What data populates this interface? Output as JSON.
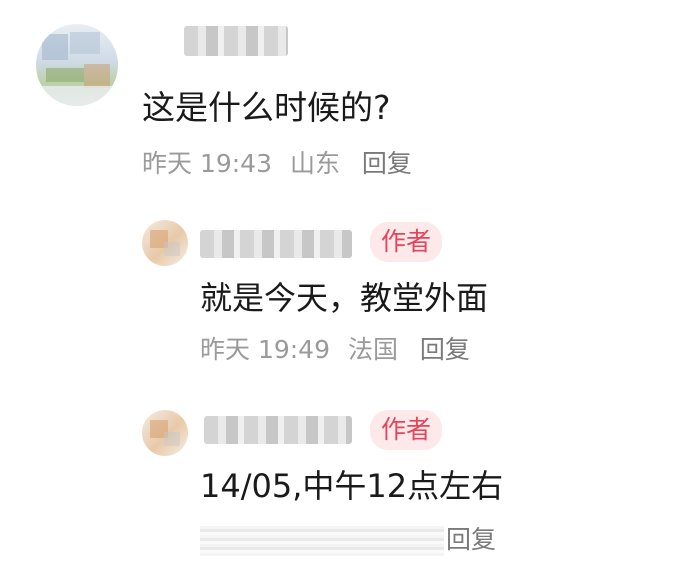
{
  "comments": [
    {
      "text": "这是什么时候的?",
      "time": "昨天 19:43",
      "location": "山东",
      "reply_label": "回复"
    },
    {
      "badge": "作者",
      "text": "就是今天，教堂外面",
      "time": "昨天 19:49",
      "location": "法国",
      "reply_label": "回复"
    },
    {
      "badge": "作者",
      "text": "14/05,中午12点左右",
      "reply_label_partial": "回复"
    }
  ]
}
